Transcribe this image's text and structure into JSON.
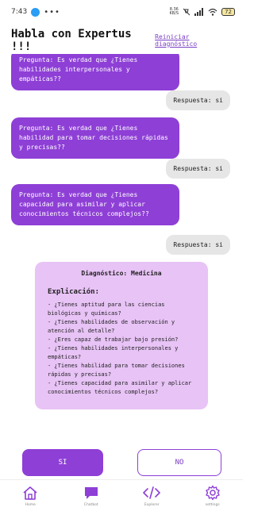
{
  "status_bar": {
    "time": "7:43",
    "dots": "•••",
    "netspeed_value": "8.36",
    "netspeed_unit": "KB/S",
    "battery": "72"
  },
  "header": {
    "title": "Habla con Expertus !!!",
    "reset_label": "Reiniciar diagnóstico"
  },
  "chat": {
    "messages": [
      {
        "from": "bot",
        "text": "Pregunta: Es verdad que ¿Tienes habilidades interpersonales y empáticas??"
      },
      {
        "from": "user",
        "text": "Respuesta: si"
      },
      {
        "from": "bot",
        "text": "Pregunta: Es verdad que ¿Tienes habilidad para tomar decisiones rápidas y precisas??"
      },
      {
        "from": "user",
        "text": "Respuesta: si"
      },
      {
        "from": "bot",
        "text": "Pregunta: Es verdad que ¿Tienes capacidad para asimilar y aplicar conocimientos técnicos complejos??"
      },
      {
        "from": "user",
        "text": "Respuesta: si"
      }
    ]
  },
  "diagnosis": {
    "title": "Diagnóstico: Medicina",
    "explanation_label": "Explicación:",
    "items": [
      "- ¿Tienes aptitud para las ciencias biológicas y químicas?",
      "- ¿Tienes habilidades de observación y atención al detalle?",
      "- ¿Eres capaz de trabajar bajo presión?",
      "- ¿Tienes habilidades interpersonales y empáticas?",
      "- ¿Tienes habilidad para tomar decisiones rápidas y precisas?",
      "- ¿Tienes capacidad para asimilar y aplicar conocimientos técnicos complejos?"
    ]
  },
  "buttons": {
    "yes_label": "SI",
    "no_label": "NO"
  },
  "bottom_nav": {
    "items": [
      {
        "label": "Home",
        "icon": "home-icon"
      },
      {
        "label": "Chatbot",
        "icon": "chat-icon"
      },
      {
        "label": "Explorer",
        "icon": "code-icon"
      },
      {
        "label": "settings",
        "icon": "gear-icon"
      }
    ]
  },
  "colors": {
    "accent": "#8e3fd6",
    "diagnosis_bg": "#e8c3f6",
    "answer_bg": "#e6e6e6"
  }
}
